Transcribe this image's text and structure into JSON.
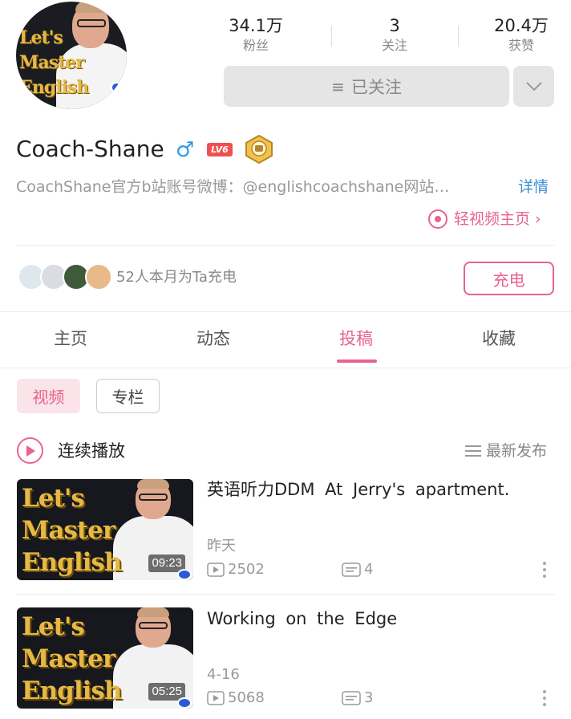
{
  "profile": {
    "username": "Coach-Shane",
    "gender_symbol": "♂",
    "level": "LV6",
    "bio": "CoachShane官方b站账号微博：@englishcoachshane网站…",
    "detail_label": "详情",
    "light_video_label": "轻视频主页 ›",
    "avatar_logo_lines": [
      "Let's",
      "Master",
      "English"
    ]
  },
  "stats": [
    {
      "value": "34.1万",
      "label": "粉丝"
    },
    {
      "value": "3",
      "label": "关注"
    },
    {
      "value": "20.4万",
      "label": "获赞"
    }
  ],
  "follow": {
    "icon": "≡",
    "label": "已关注",
    "dropdown_icon": "chevron-down-icon"
  },
  "charge": {
    "text": "52人本月为Ta充电",
    "button_label": "充电"
  },
  "tabs": [
    {
      "label": "主页",
      "active": false
    },
    {
      "label": "动态",
      "active": false
    },
    {
      "label": "投稿",
      "active": true
    },
    {
      "label": "收藏",
      "active": false
    }
  ],
  "filters": [
    {
      "label": "视频",
      "active": true
    },
    {
      "label": "专栏",
      "active": false
    }
  ],
  "playback": {
    "continuous_label": "连续播放",
    "sort_label": "最新发布"
  },
  "videos": [
    {
      "title": "英语听力DDM At Jerry's apartment.",
      "date": "昨天",
      "plays": "2502",
      "danmaku": "4",
      "duration": "09:23",
      "thumb_logo_lines": [
        "Let's",
        "Master",
        "English"
      ]
    },
    {
      "title": "Working on the Edge",
      "date": "4-16",
      "plays": "5068",
      "danmaku": "3",
      "duration": "05:25",
      "thumb_logo_lines": [
        "Let's",
        "Master",
        "English"
      ]
    }
  ],
  "colors": {
    "accent_pink": "#e8638e",
    "link_blue": "#3b8fd6",
    "gender_blue": "#2f9be4",
    "level_red": "#f05050"
  }
}
